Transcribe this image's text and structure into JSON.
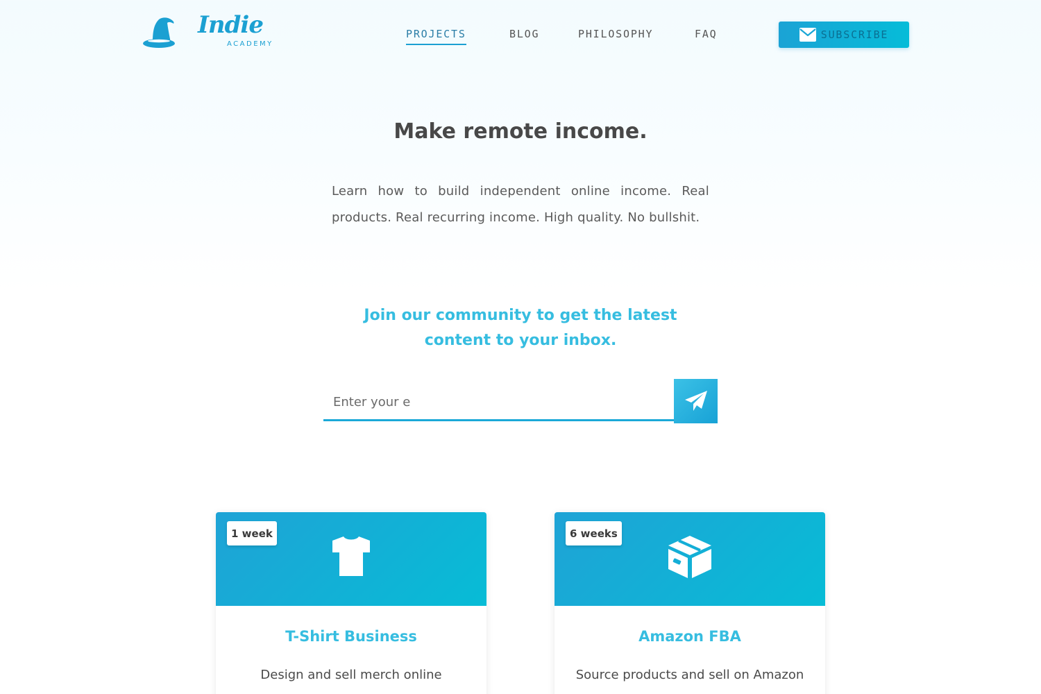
{
  "brand": {
    "script": "Indie",
    "sub": "ACADEMY"
  },
  "nav": {
    "items": [
      {
        "label": "PROJECTS",
        "active": true
      },
      {
        "label": "BLOG",
        "active": false
      },
      {
        "label": "PHILOSOPHY",
        "active": false
      },
      {
        "label": "FAQ",
        "active": false
      }
    ],
    "subscribe_label": "SUBSCRIBE",
    "subscribe_icon": "envelope-icon"
  },
  "hero": {
    "title": "Make remote income.",
    "description": "Learn how to build independent online income. Real products. Real recurring income. High quality. No bullshit."
  },
  "community": {
    "heading_line1": "Join our community to get the latest",
    "heading_line2": "content to your inbox.",
    "email_placeholder": "Enter your e",
    "submit_icon": "paper-plane-icon"
  },
  "projects": [
    {
      "duration": "1 week",
      "icon": "tshirt-icon",
      "title": "T-Shirt Business",
      "description": "Design and sell merch online"
    },
    {
      "duration": "6 weeks",
      "icon": "package-box-icon",
      "title": "Amazon FBA",
      "description": "Source products and sell on Amazon"
    }
  ],
  "colors": {
    "accent": "#1ba0d2",
    "accent_light": "#36bde0",
    "gradient_end": "#06bcd8",
    "text_dark": "#484848"
  }
}
